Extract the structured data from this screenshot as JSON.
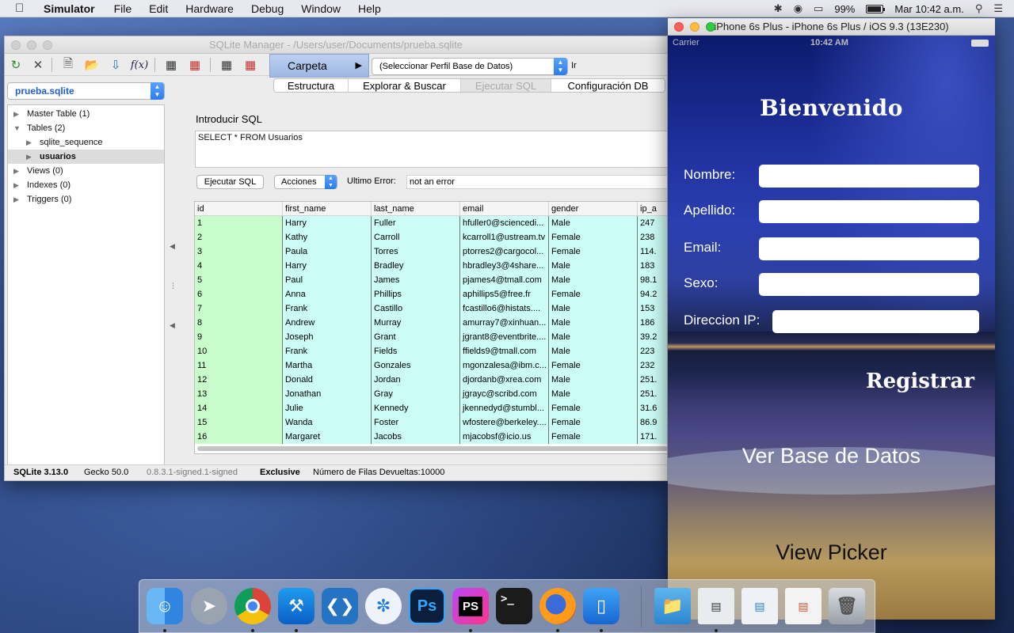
{
  "menubar": {
    "app_name": "Simulator",
    "items": [
      "File",
      "Edit",
      "Hardware",
      "Debug",
      "Window",
      "Help"
    ],
    "battery": "99%",
    "clock": "Mar 10:42 a.m."
  },
  "sqlite": {
    "window_title": "SQLite Manager - /Users/user/Documents/prueba.sqlite",
    "carpeta_label": "Carpeta",
    "profile_select": "(Seleccionar Perfil Base de Datos)",
    "ir_label": "Ir",
    "tabs": [
      "Estructura",
      "Explorar & Buscar",
      "Ejecutar SQL",
      "Configuración DB"
    ],
    "active_tab": "Ejecutar SQL",
    "db_select": "prueba.sqlite",
    "tree": [
      {
        "label": "Master Table (1)",
        "expanded": false
      },
      {
        "label": "Tables (2)",
        "expanded": true
      },
      {
        "label": "sqlite_sequence",
        "expanded": false
      },
      {
        "label": "usuarios",
        "expanded": false,
        "selected": true
      },
      {
        "label": "Views (0)",
        "expanded": false
      },
      {
        "label": "Indexes (0)",
        "expanded": false
      },
      {
        "label": "Triggers (0)",
        "expanded": false
      }
    ],
    "sql_label": "Introducir SQL",
    "sql_text": "SELECT * FROM Usuarios",
    "run_button": "Ejecutar SQL",
    "actions_button": "Acciones",
    "error_label": "Ultimo Error:",
    "error_value": "not an error",
    "columns": [
      "id",
      "first_name",
      "last_name",
      "email",
      "gender",
      "ip_a"
    ],
    "rows": [
      [
        "1",
        "Harry",
        "Fuller",
        "hfuller0@sciencedi...",
        "Male",
        "247"
      ],
      [
        "2",
        "Kathy",
        "Carroll",
        "kcarroll1@ustream.tv",
        "Female",
        "238"
      ],
      [
        "3",
        "Paula",
        "Torres",
        "ptorres2@cargocol...",
        "Female",
        "114."
      ],
      [
        "4",
        "Harry",
        "Bradley",
        "hbradley3@4share...",
        "Male",
        "183"
      ],
      [
        "5",
        "Paul",
        "James",
        "pjames4@tmall.com",
        "Male",
        "98.1"
      ],
      [
        "6",
        "Anna",
        "Phillips",
        "aphillips5@free.fr",
        "Female",
        "94.2"
      ],
      [
        "7",
        "Frank",
        "Castillo",
        "fcastillo6@histats....",
        "Male",
        "153"
      ],
      [
        "8",
        "Andrew",
        "Murray",
        "amurray7@xinhuan...",
        "Male",
        "186"
      ],
      [
        "9",
        "Joseph",
        "Grant",
        "jgrant8@eventbrite....",
        "Male",
        "39.2"
      ],
      [
        "10",
        "Frank",
        "Fields",
        "ffields9@tmall.com",
        "Male",
        "223"
      ],
      [
        "11",
        "Martha",
        "Gonzales",
        "mgonzalesa@ibm.c...",
        "Female",
        "232"
      ],
      [
        "12",
        "Donald",
        "Jordan",
        "djordanb@xrea.com",
        "Male",
        "251."
      ],
      [
        "13",
        "Jonathan",
        "Gray",
        "jgrayc@scribd.com",
        "Male",
        "251."
      ],
      [
        "14",
        "Julie",
        "Kennedy",
        "jkennedyd@stumbl...",
        "Female",
        "31.6"
      ],
      [
        "15",
        "Wanda",
        "Foster",
        "wfostere@berkeley....",
        "Female",
        "86.9"
      ],
      [
        "16",
        "Margaret",
        "Jacobs",
        "mjacobsf@icio.us",
        "Female",
        "171."
      ]
    ],
    "status": {
      "sqlite_version": "SQLite 3.13.0",
      "gecko": "Gecko 50.0",
      "build": "0.8.3.1-signed.1-signed",
      "mode": "Exclusive",
      "rows_returned": "Número de Filas Devueltas:10000"
    }
  },
  "simulator": {
    "window_title": "iPhone 6s Plus - iPhone 6s Plus / iOS 9.3 (13E230)",
    "carrier": "Carrier",
    "time": "10:42 AM",
    "welcome": "Bienvenido",
    "fields": [
      {
        "label": "Nombre:",
        "value": ""
      },
      {
        "label": "Apellido:",
        "value": ""
      },
      {
        "label": "Email:",
        "value": ""
      },
      {
        "label": "Sexo:",
        "value": ""
      },
      {
        "label": "Direccion IP:",
        "value": ""
      }
    ],
    "register_button": "Registrar",
    "view_db_button": "Ver Base de Datos",
    "view_picker_button": "View Picker"
  },
  "dock": {
    "apps": [
      "finder-icon",
      "launchpad-icon",
      "chrome-icon",
      "xcode-icon",
      "vscode-icon",
      "safari-icon",
      "photoshop-icon",
      "phpstorm-icon",
      "terminal-icon",
      "firefox-icon",
      "simulator-icon"
    ],
    "ps_label": "Ps",
    "pstorm_label": "PS"
  }
}
